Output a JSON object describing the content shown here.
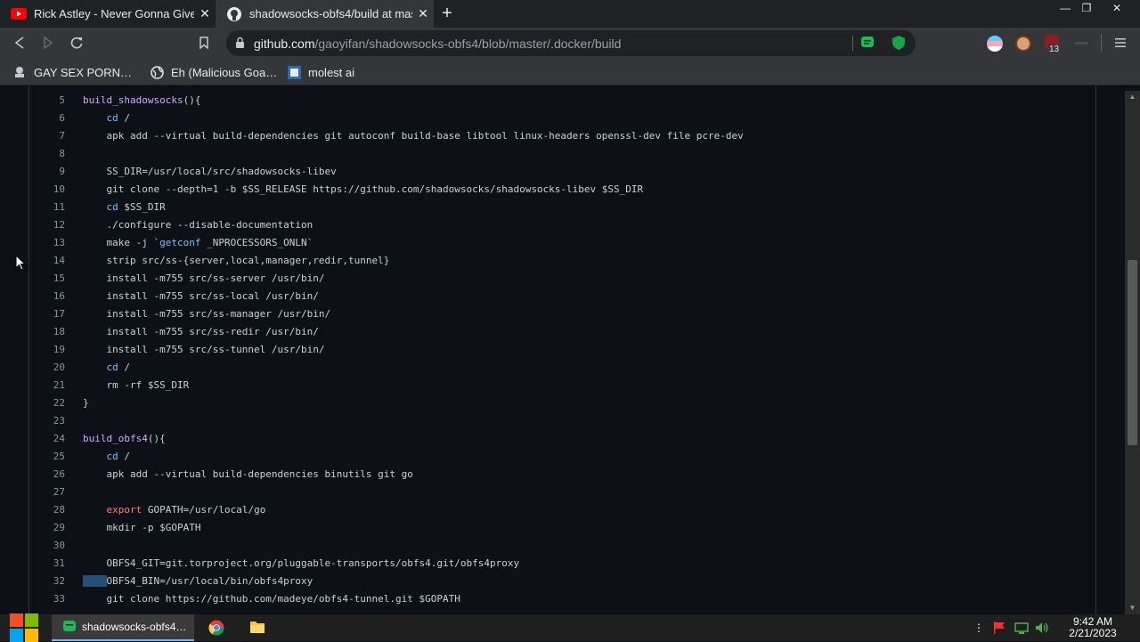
{
  "browser": {
    "tabs": [
      {
        "title": "Rick Astley - Never Gonna Give",
        "favicon": "youtube-icon",
        "active": false
      },
      {
        "title": "shadowsocks-obfs4/build at mas",
        "favicon": "github-icon",
        "active": true
      }
    ],
    "url_host": "github.com",
    "url_path": "/gaoyifan/shadowsocks-obfs4/blob/master/.docker/build",
    "extension_badge": "13",
    "bookmarks": [
      {
        "label": "GAY SEX PORN…",
        "icon": "bookmark-icon"
      },
      {
        "label": "Eh (Malicious Goa…",
        "icon": "globe-icon"
      },
      {
        "label": "molest ai",
        "icon": "bookmark-icon"
      }
    ]
  },
  "code": {
    "lines": [
      {
        "n": "5",
        "text": "build_shadowsocks(){"
      },
      {
        "n": "6",
        "text": "    cd /"
      },
      {
        "n": "7",
        "text": "    apk add --virtual build-dependencies git autoconf build-base libtool linux-headers openssl-dev file pcre-dev"
      },
      {
        "n": "8",
        "text": ""
      },
      {
        "n": "9",
        "text": "    SS_DIR=/usr/local/src/shadowsocks-libev"
      },
      {
        "n": "10",
        "text": "    git clone --depth=1 -b $SS_RELEASE https://github.com/shadowsocks/shadowsocks-libev $SS_DIR"
      },
      {
        "n": "11",
        "text": "    cd $SS_DIR"
      },
      {
        "n": "12",
        "text": "    ./configure --disable-documentation"
      },
      {
        "n": "13",
        "text": "    make -j `getconf _NPROCESSORS_ONLN`"
      },
      {
        "n": "14",
        "text": "    strip src/ss-{server,local,manager,redir,tunnel}"
      },
      {
        "n": "15",
        "text": "    install -m755 src/ss-server /usr/bin/"
      },
      {
        "n": "16",
        "text": "    install -m755 src/ss-local /usr/bin/"
      },
      {
        "n": "17",
        "text": "    install -m755 src/ss-manager /usr/bin/"
      },
      {
        "n": "18",
        "text": "    install -m755 src/ss-redir /usr/bin/"
      },
      {
        "n": "19",
        "text": "    install -m755 src/ss-tunnel /usr/bin/"
      },
      {
        "n": "20",
        "text": "    cd /"
      },
      {
        "n": "21",
        "text": "    rm -rf $SS_DIR"
      },
      {
        "n": "22",
        "text": "}"
      },
      {
        "n": "23",
        "text": ""
      },
      {
        "n": "24",
        "text": "build_obfs4(){"
      },
      {
        "n": "25",
        "text": "    cd /"
      },
      {
        "n": "26",
        "text": "    apk add --virtual build-dependencies binutils git go"
      },
      {
        "n": "27",
        "text": ""
      },
      {
        "n": "28",
        "text": "    export GOPATH=/usr/local/go"
      },
      {
        "n": "29",
        "text": "    mkdir -p $GOPATH"
      },
      {
        "n": "30",
        "text": ""
      },
      {
        "n": "31",
        "text": "    OBFS4_GIT=git.torproject.org/pluggable-transports/obfs4.git/obfs4proxy"
      },
      {
        "n": "32",
        "text": "    OBFS4_BIN=/usr/local/bin/obfs4proxy"
      },
      {
        "n": "33",
        "text": "    git clone https://github.com/madeye/obfs4-tunnel.git $GOPATH"
      }
    ]
  },
  "taskbar": {
    "active_task": "shadowsocks-obfs4…",
    "time": "9:42 AM",
    "date": "2/21/2023"
  },
  "colors": {
    "function_name": "#d2a8ff",
    "keyword": "#ff7b72",
    "builtin": "#79c0ff",
    "selection": "#264f78"
  }
}
